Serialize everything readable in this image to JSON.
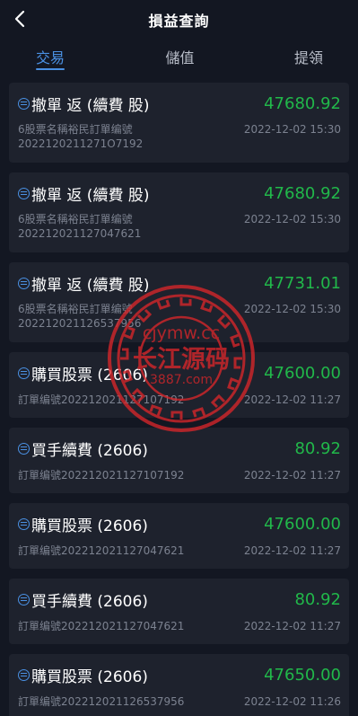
{
  "header": {
    "title": "損益查詢",
    "back_icon": "chevron-left-icon"
  },
  "tabs": [
    {
      "label": "交易",
      "active": true
    },
    {
      "label": "儲值",
      "active": false
    },
    {
      "label": "提領",
      "active": false
    }
  ],
  "records": [
    {
      "name": "撤單 返 (續費 股)",
      "amount": "47680.92",
      "sub1": "6股票名稱裕民訂單编號",
      "sub2": "2022120211271O7192",
      "time": "2022-12-02 15:30"
    },
    {
      "name": "撤單 返 (續費 股)",
      "amount": "47680.92",
      "sub1": "6股票名稱裕民訂單编號",
      "sub2": "202212021127047621",
      "time": "2022-12-02 15:30"
    },
    {
      "name": "撤單 返 (續費 股)",
      "amount": "47731.01",
      "sub1": "6股票名稱裕民訂單编號",
      "sub2": "202212021126537956",
      "time": "2022-12-02 15:30"
    },
    {
      "name": "購買股票 (2606)",
      "amount": "47600.00",
      "sub1": "訂單编號202212021127107192",
      "time": "2022-12-02 11:27"
    },
    {
      "name": "買手續費 (2606)",
      "amount": "80.92",
      "sub1": "訂單编號202212021127107192",
      "time": "2022-12-02 11:27"
    },
    {
      "name": "購買股票 (2606)",
      "amount": "47600.00",
      "sub1": "訂單编號202212021127047621",
      "time": "2022-12-02 11:27"
    },
    {
      "name": "買手續費 (2606)",
      "amount": "80.92",
      "sub1": "訂單编號202212021127047621",
      "time": "2022-12-02 11:27"
    },
    {
      "name": "購買股票 (2606)",
      "amount": "47650.00",
      "sub1": "訂單编號202212021126537956",
      "time": "2022-12-02 11:26"
    }
  ],
  "watermark": {
    "line1": "cjymw.cc",
    "line2": "长江源码",
    "line3": "3887.com",
    "color": "#d8262a"
  },
  "colors": {
    "accent": "#4a90e2",
    "positive": "#21b84a",
    "card_bg": "#1e222d",
    "page_bg": "#131722"
  }
}
